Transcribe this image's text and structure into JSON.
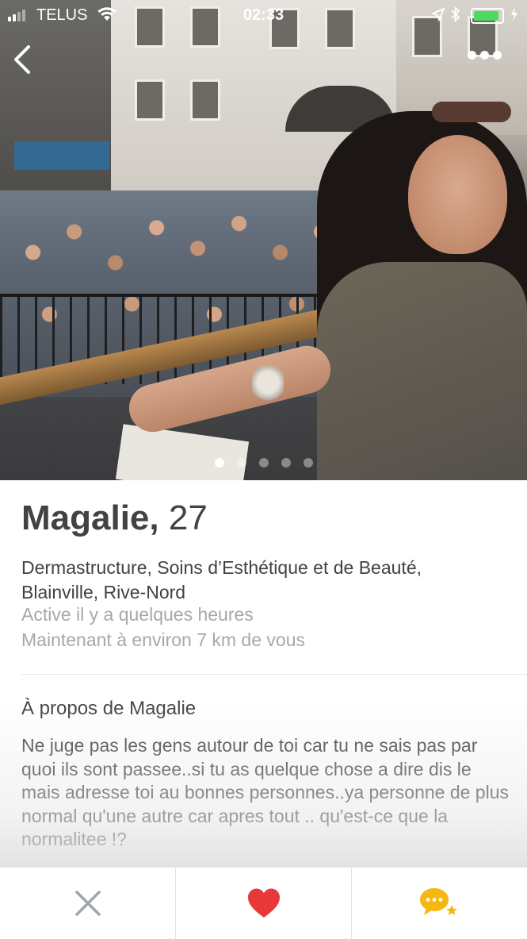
{
  "status_bar": {
    "carrier": "TELUS",
    "time": "02:33",
    "battery_percent": 90
  },
  "photo": {
    "count": 5,
    "current_index": 0
  },
  "profile": {
    "name": "Magalie,",
    "age": "27",
    "work": "Dermastructure, Soins d’Esthétique et de Beauté,",
    "location": "Blainville, Rive-Nord",
    "activity": "Active il y a quelques heures",
    "distance": "Maintenant à environ 7 km de vous"
  },
  "about": {
    "title": "À propos de Magalie",
    "text": "Ne juge pas les gens autour de toi car tu ne sais pas par quoi ils sont passee..si tu as quelque chose a dire dis le mais adresse toi au bonnes personnes..ya personne de plus normal qu'une autre car apres tout .. qu'est-ce que la normalitee !?"
  },
  "colors": {
    "like": "#e8393a",
    "nope": "#9fa5ab",
    "super_chat": "#f5b712",
    "text": "#424242",
    "muted": "#a8a8a8"
  },
  "icons": {
    "back": "chevron-left-icon",
    "more": "more-dots-icon",
    "nope": "close-icon",
    "like": "heart-icon",
    "chat": "chat-star-icon"
  }
}
